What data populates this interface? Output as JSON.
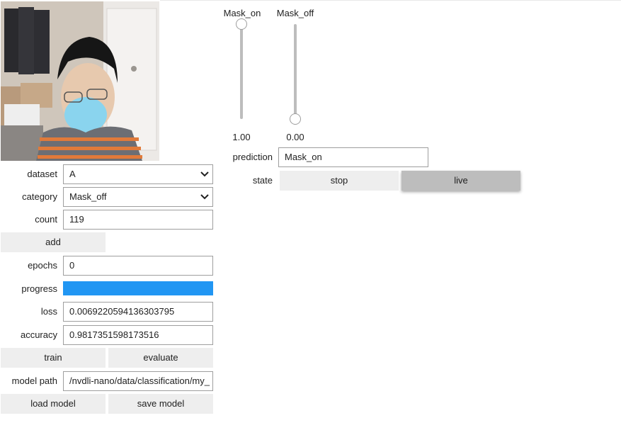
{
  "camera": {
    "icon": "camera-feed-image"
  },
  "form": {
    "dataset": {
      "label": "dataset",
      "value": "A"
    },
    "category": {
      "label": "category",
      "value": "Mask_off"
    },
    "count": {
      "label": "count",
      "value": "119"
    },
    "add_label": "add",
    "epochs": {
      "label": "epochs",
      "value": "0"
    },
    "progress": {
      "label": "progress",
      "fraction": 1.0,
      "color": "#2196f3"
    },
    "loss": {
      "label": "loss",
      "value": "0.0069220594136303795"
    },
    "accuracy": {
      "label": "accuracy",
      "value": "0.9817351598173516"
    },
    "train_label": "train",
    "evaluate_label": "evaluate",
    "model_path": {
      "label": "model path",
      "value": "/nvdli-nano/data/classification/my_"
    },
    "load_label": "load model",
    "save_label": "save model"
  },
  "sliders": [
    {
      "name": "Mask_on",
      "value": "1.00",
      "level": 1.0
    },
    {
      "name": "Mask_off",
      "value": "0.00",
      "level": 0.0
    }
  ],
  "prediction": {
    "label": "prediction",
    "value": "Mask_on"
  },
  "state": {
    "label": "state",
    "stop_label": "stop",
    "live_label": "live",
    "active": "live"
  }
}
